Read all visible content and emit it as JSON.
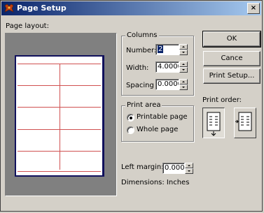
{
  "window": {
    "title": "Page Setup",
    "close_label": "×"
  },
  "preview": {
    "label": "Page layout:"
  },
  "columns": {
    "legend": "Columns",
    "number_label": "Number:",
    "number_value": "2",
    "width_label": "Width:",
    "width_value": "4.0000",
    "spacing_label": "Spacing",
    "spacing_value": "0.0000"
  },
  "print_area": {
    "legend": "Print area",
    "options": [
      {
        "label": "Printable page",
        "checked": true
      },
      {
        "label": "Whole page",
        "checked": false
      }
    ]
  },
  "margin": {
    "label": "Left margin:",
    "value": "0.0000"
  },
  "dimensions": {
    "text": "Dimensions: Inches"
  },
  "buttons": {
    "ok": "OK",
    "cancel": "Cance",
    "print_setup": "Print Setup..."
  },
  "print_order": {
    "label": "Print order:"
  }
}
